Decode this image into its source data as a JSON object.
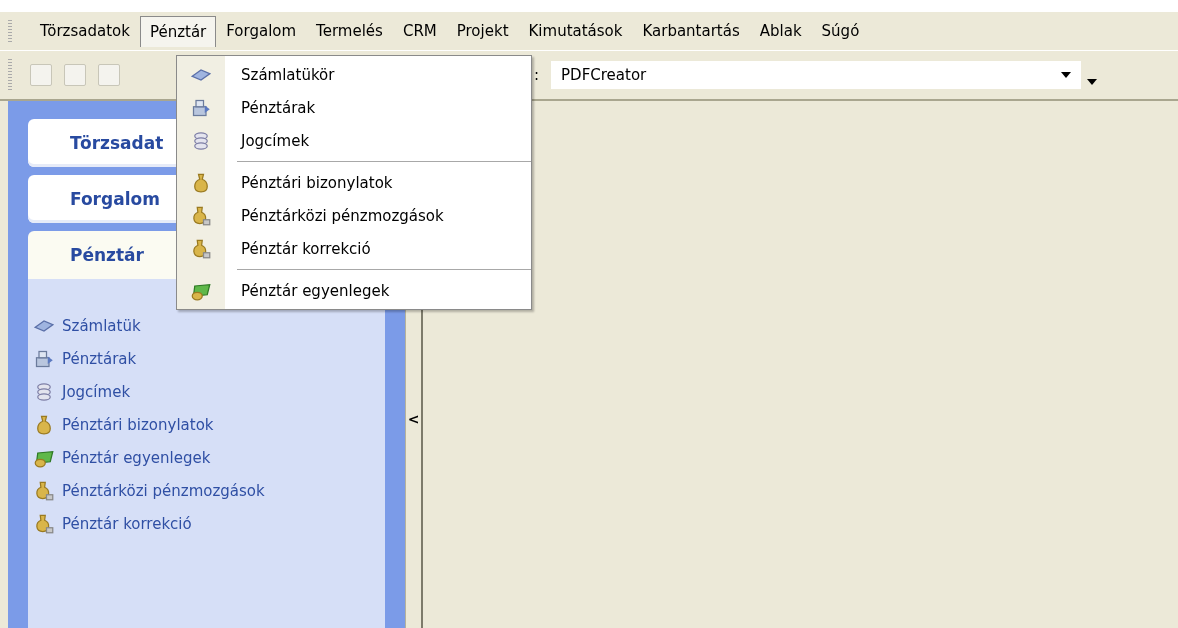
{
  "menubar": [
    {
      "label": "Törzsadatok",
      "selected": false
    },
    {
      "label": "Pénztár",
      "selected": true
    },
    {
      "label": "Forgalom",
      "selected": false
    },
    {
      "label": "Termelés",
      "selected": false
    },
    {
      "label": "CRM",
      "selected": false
    },
    {
      "label": "Projekt",
      "selected": false
    },
    {
      "label": "Kimutatások",
      "selected": false
    },
    {
      "label": "Karbantartás",
      "selected": false
    },
    {
      "label": "Ablak",
      "selected": false
    },
    {
      "label": "Súgó",
      "selected": false
    }
  ],
  "toolbar": {
    "printer_label": ":",
    "printer": "PDFCreator"
  },
  "sidebar": {
    "tabs": [
      {
        "label": "Törzsadat",
        "selected": false
      },
      {
        "label": "Forgalom",
        "selected": false
      },
      {
        "label": "Pénztár",
        "selected": true
      }
    ],
    "items": [
      {
        "label": "Számlatük"
      },
      {
        "label": "Pénztárak"
      },
      {
        "label": "Jogcímek"
      },
      {
        "label": "Pénztári bizonylatok"
      },
      {
        "label": "Pénztár egyenlegek"
      },
      {
        "label": "Pénztárközi pénzmozgások"
      },
      {
        "label": "Pénztár korrekció"
      }
    ],
    "collapse": "<"
  },
  "menu": {
    "items": [
      {
        "kind": "item",
        "label": "Számlatükör"
      },
      {
        "kind": "item",
        "label": "Pénztárak"
      },
      {
        "kind": "item",
        "label": "Jogcímek"
      },
      {
        "kind": "separator"
      },
      {
        "kind": "item",
        "label": "Pénztári bizonylatok"
      },
      {
        "kind": "item",
        "label": "Pénztárközi pénzmozgások"
      },
      {
        "kind": "item",
        "label": "Pénztár korrekció"
      },
      {
        "kind": "separator"
      },
      {
        "kind": "item",
        "label": "Pénztár egyenlegek"
      }
    ]
  }
}
